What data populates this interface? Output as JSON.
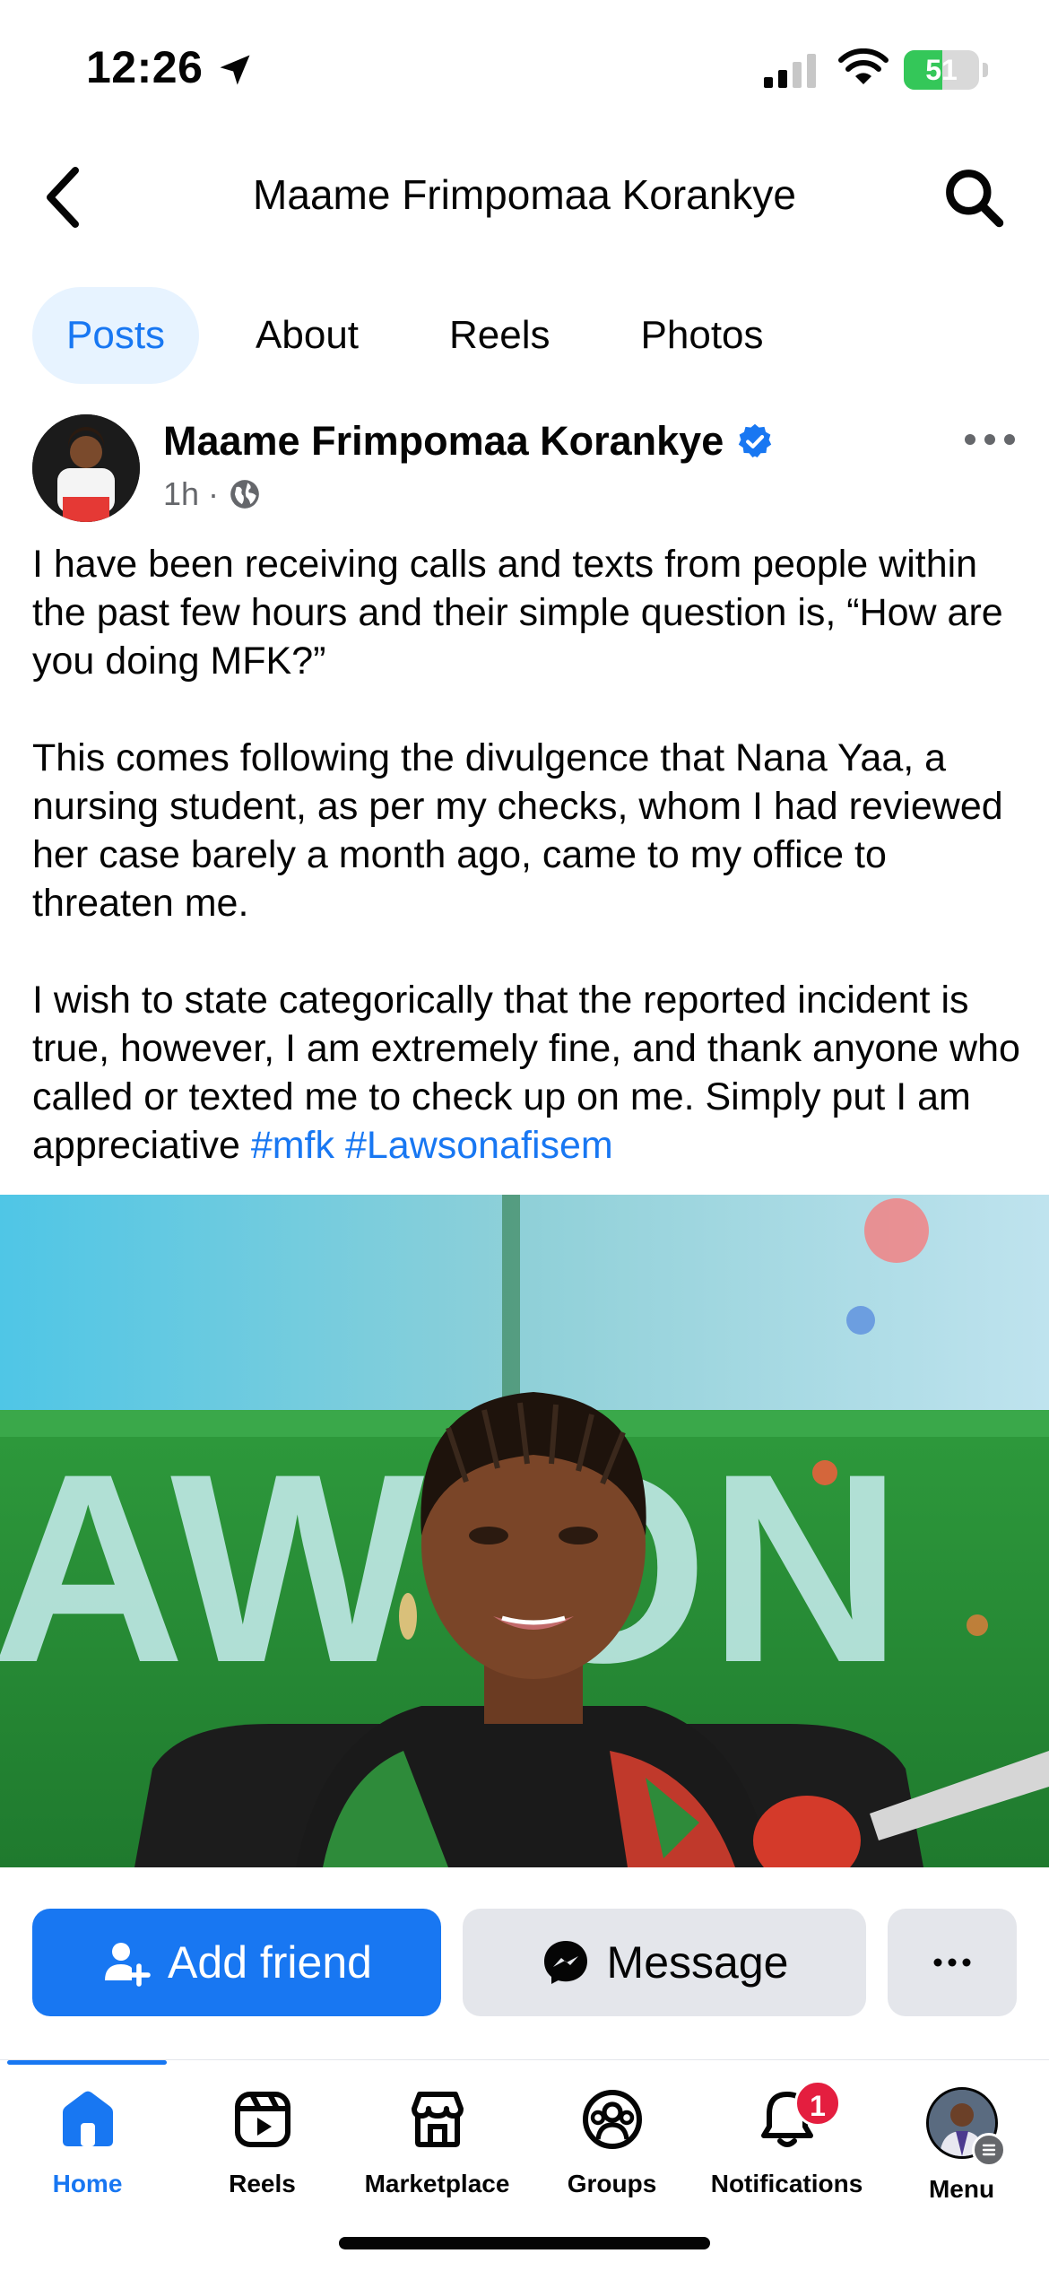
{
  "status_bar": {
    "time": "12:26",
    "battery": "51",
    "battery_level": 0.51
  },
  "header": {
    "title": "Maame Frimpomaa Korankye"
  },
  "tabs": [
    {
      "label": "Posts",
      "active": true
    },
    {
      "label": "About",
      "active": false
    },
    {
      "label": "Reels",
      "active": false
    },
    {
      "label": "Photos",
      "active": false
    }
  ],
  "post": {
    "author": "Maame Frimpomaa Korankye",
    "verified": true,
    "time": "1h",
    "separator": "·",
    "paragraphs": [
      "I have been receiving calls and texts from people within the past few hours and their simple question is, “How are you doing MFK?”",
      "This comes following the divulgence that Nana Yaa, a nursing student, as per my checks, whom I had reviewed her case barely a month ago, came to my office to threaten me.",
      "I wish to state categorically that the reported incident is true, however, I am extremely fine, and thank anyone who called or texted me to check up on me. Simply put I am appreciative"
    ],
    "hashtags": [
      "#mfk",
      "#Lawsonafisem"
    ],
    "image_sign_text": "AW ON"
  },
  "actions": {
    "add_friend": "Add friend",
    "message": "Message"
  },
  "nav": [
    {
      "label": "Home",
      "icon": "home-icon",
      "active": true
    },
    {
      "label": "Reels",
      "icon": "reels-icon",
      "active": false
    },
    {
      "label": "Marketplace",
      "icon": "marketplace-icon",
      "active": false
    },
    {
      "label": "Groups",
      "icon": "groups-icon",
      "active": false
    },
    {
      "label": "Notifications",
      "icon": "bell-icon",
      "active": false,
      "badge": "1"
    },
    {
      "label": "Menu",
      "icon": "profile-avatar",
      "active": false
    }
  ],
  "colors": {
    "accent": "#1877f2",
    "badge": "#e41e3f",
    "tab_active_bg": "#e7f3ff",
    "secondary_button": "#e4e6eb",
    "battery": "#34c759"
  }
}
